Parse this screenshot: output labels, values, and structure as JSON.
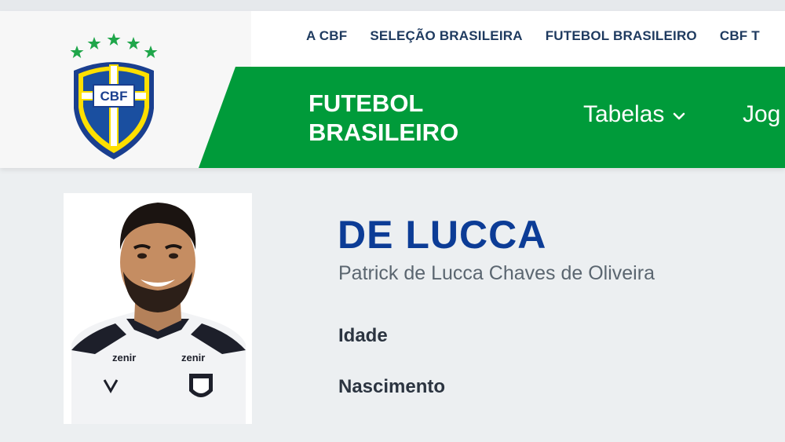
{
  "brand": {
    "logo_text": "CBF",
    "accent_green": "#009b3a",
    "accent_yellow": "#fedf00",
    "accent_blue": "#1a4fa0",
    "name_blue": "#0c3c96"
  },
  "top_nav": {
    "items": [
      "A CBF",
      "SELEÇÃO BRASILEIRA",
      "FUTEBOL BRASILEIRO",
      "CBF T"
    ]
  },
  "section": {
    "title_line1": "FUTEBOL",
    "title_line2": "BRASILEIRO"
  },
  "menu": {
    "tabelas": "Tabelas",
    "jogos": "Jog"
  },
  "icons": {
    "dropdown": "chevron-down-icon",
    "logo": "cbf-crest-logo"
  },
  "player": {
    "name": "DE LUCCA",
    "full_name": "Patrick de Lucca Chaves de Oliveira",
    "labels": {
      "age": "Idade",
      "birth": "Nascimento"
    },
    "photo": {
      "shirt_sponsor": "zenir"
    }
  }
}
